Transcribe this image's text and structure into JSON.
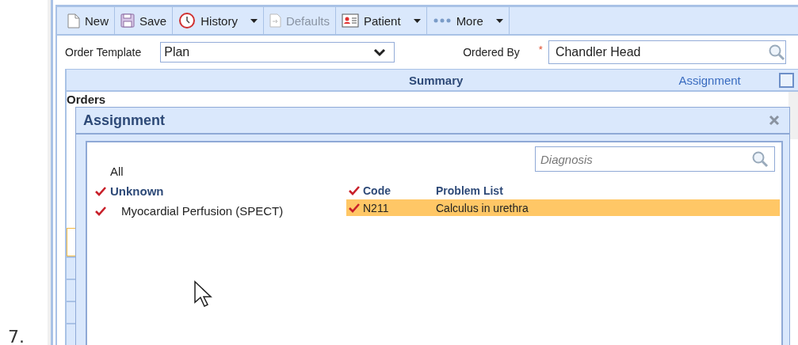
{
  "list_number": "7.",
  "toolbar": [
    {
      "kind": "new",
      "label": "New",
      "disabled": false,
      "menu": false
    },
    {
      "kind": "save",
      "label": "Save",
      "disabled": false,
      "menu": false
    },
    {
      "kind": "history",
      "label": "History",
      "disabled": false,
      "menu": true
    },
    {
      "kind": "defaults",
      "label": "Defaults",
      "disabled": true,
      "menu": false
    },
    {
      "kind": "patient",
      "label": "Patient",
      "disabled": false,
      "menu": true
    },
    {
      "kind": "more",
      "label": "More",
      "disabled": false,
      "menu": true
    }
  ],
  "form": {
    "template_label": "Order Template",
    "template_value": "Plan",
    "ordered_by_label": "Ordered By",
    "required_mark": "*",
    "ordered_by_value": "Chandler Head"
  },
  "grid": {
    "summary_header": "Summary",
    "assignment_header": "Assignment",
    "select_all_checked": false,
    "orders_label": "Orders"
  },
  "dialog": {
    "title": "Assignment",
    "search": {
      "placeholder": "Diagnosis"
    },
    "tree": [
      {
        "label": "All",
        "checked": false,
        "children": [
          {
            "label": "Unknown",
            "checked": true,
            "bold": true,
            "children": [
              {
                "label": "Myocardial Perfusion (SPECT)",
                "checked": true
              }
            ]
          }
        ]
      }
    ],
    "columns": [
      {
        "label": "Code",
        "checked": true
      },
      {
        "label": "Problem List",
        "checked": false
      }
    ],
    "rows": [
      {
        "code": "N211",
        "problem": "Calculus in urethra",
        "checked": true,
        "selected": true
      }
    ]
  }
}
